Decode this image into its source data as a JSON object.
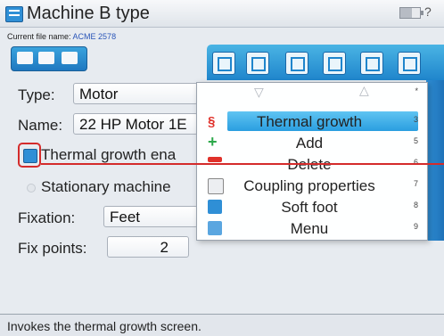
{
  "window": {
    "title": "Machine B type"
  },
  "file": {
    "label": "Current file name:",
    "name": "ACME 2578"
  },
  "form": {
    "type_label": "Type:",
    "type_value": "Motor",
    "name_label": "Name:",
    "name_value": "22 HP Motor 1E",
    "thermal_label": "Thermal growth ena",
    "stationary_label": "Stationary machine",
    "fixation_label": "Fixation:",
    "fixation_value": "Feet",
    "fixpoints_label": "Fix points:",
    "fixpoints_value": "2"
  },
  "menu": {
    "items": [
      {
        "label": "Thermal growth",
        "key": "3",
        "icon": "thermal-growth-icon",
        "selected": true
      },
      {
        "label": "Add",
        "key": "5",
        "icon": "add-icon"
      },
      {
        "label": "Delete",
        "key": "6",
        "icon": "delete-icon"
      },
      {
        "label": "Coupling properties",
        "key": "7",
        "icon": "coupling-icon"
      },
      {
        "label": "Soft foot",
        "key": "8",
        "icon": "soft-foot-icon"
      },
      {
        "label": "Menu",
        "key": "9",
        "icon": "menu-icon"
      }
    ],
    "top_key": "*"
  },
  "status": {
    "text": "Invokes the thermal growth screen."
  },
  "colors": {
    "accent": "#2a9ee0",
    "highlight": "#d42b2b"
  }
}
